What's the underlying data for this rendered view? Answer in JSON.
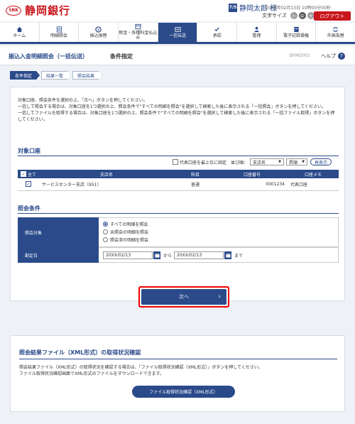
{
  "header": {
    "bank_name": "静岡銀行",
    "logo_mark": "SBK",
    "user_badge": "7/5",
    "user_name": "静岡太郎 様",
    "login_time": "20XX年02月13日 10時00分00秒",
    "font_size_label": "文字サイズ",
    "font_sizes": [
      "小",
      "中",
      "大"
    ],
    "logout": "ログアウト"
  },
  "nav": [
    {
      "label": "ホーム",
      "icon": "home-icon"
    },
    {
      "label": "明細照会",
      "icon": "statement-icon"
    },
    {
      "label": "振込振替",
      "icon": "transfer-icon"
    },
    {
      "label": "税金・各種料金払込み",
      "icon": "tax-payment-icon"
    },
    {
      "label": "一括伝送",
      "icon": "bulk-transfer-icon",
      "active": true
    },
    {
      "label": "承認",
      "icon": "approval-icon"
    },
    {
      "label": "管理",
      "icon": "management-icon"
    },
    {
      "label": "電子記録債権",
      "icon": "receivable-icon"
    },
    {
      "label": "外国為替",
      "icon": "forex-icon"
    }
  ],
  "titlebar": {
    "title": "振込入金明細照会（一括伝送）",
    "subtitle": "条件指定",
    "screen_id": "BFMD001",
    "help": "ヘルプ"
  },
  "steps": [
    "条件指定",
    "結果一覧",
    "照会結果"
  ],
  "instructions": [
    "対象口座、照会条件を選択の上、「次へ」ボタンを押してください。",
    "一括して照会する場合は、対象口座を1つ選択の上、照会条件で\"すべての明細を照会\"を選択して検索した後に表示される「一括照会」ボタンを押してください。",
    "一括してファイルを取得する場合は、対象口座を1つ選択の上、照会条件で\"すべての明細を照会\"を選択して検索した後に表示される「一括ファイル取得」ボタンを押してください。"
  ],
  "account_section": {
    "title": "対象口座",
    "top_fix_label": "代表口座を最上位に固定",
    "sort_label": "並び順：",
    "sort_value": "支店名",
    "order_value": "昇順",
    "redisplay": "再表示",
    "columns": [
      "全て",
      "支店名",
      "科目",
      "口座番号",
      "口座メモ"
    ],
    "rows": [
      {
        "branch": "サービスセンター支店（951）",
        "type": "普通",
        "number": "0001234",
        "memo": "代表口座"
      }
    ]
  },
  "conditions": {
    "title": "照会条件",
    "target_label": "照会対象",
    "options": [
      "すべての明細を照会",
      "未照会の明細を照会",
      "照会済の明細を照会"
    ],
    "date_label": "勘定日",
    "date_from": "20XX/02/13",
    "date_to": "20XX/02/13",
    "from_sep": "から",
    "to_sep": "まで"
  },
  "next_button": "次へ",
  "xml_section": {
    "title": "照会結果ファイル（XML形式）の取得状況確認",
    "text1": "照会結果ファイル（XML形式）の取得状況を確認する場合は、「ファイル取得状況確認（XML形式）」ボタンを押してください。",
    "text2": "ファイル取得状況確認画面でXML形式のファイルをダウンロードできます。",
    "button": "ファイル取得状況確認（XML形式）"
  },
  "colors": {
    "brand": "#c8161d",
    "primary": "#2a4a8a",
    "highlight": "#e00000"
  }
}
